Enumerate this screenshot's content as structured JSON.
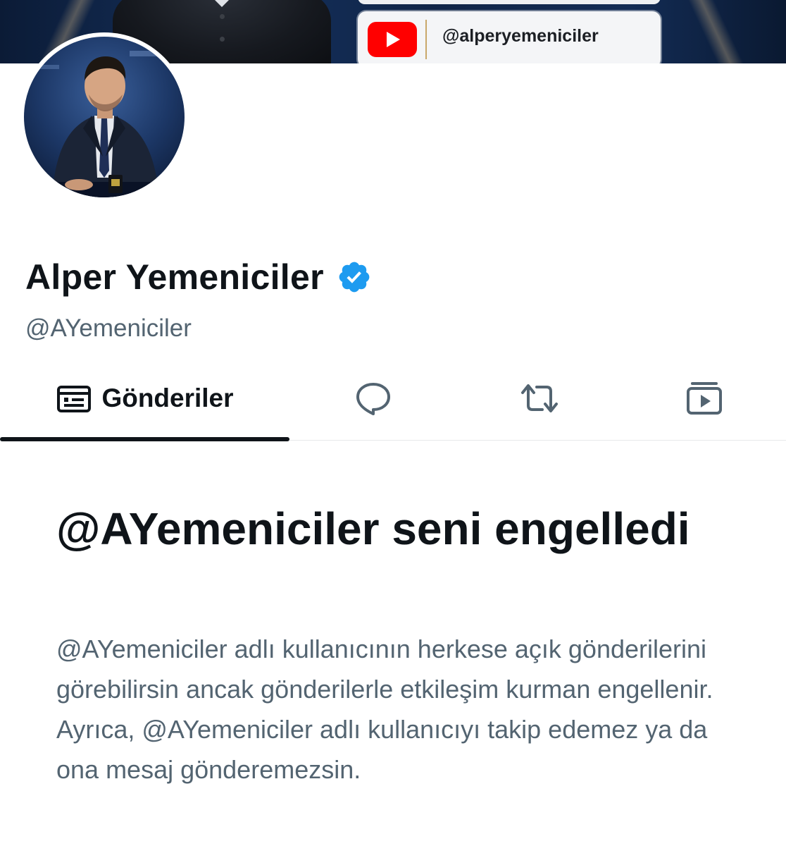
{
  "banner": {
    "youtube_handle": "@alperyemeniciler",
    "youtube_red": "#ff0000"
  },
  "profile": {
    "display_name": "Alper Yemeniciler",
    "handle": "@AYemeniciler",
    "verified": true,
    "verified_color": "#1d9bf0"
  },
  "tabs": [
    {
      "label": "Gönderiler",
      "icon": "posts-icon",
      "selected": true
    },
    {
      "label": "",
      "icon": "reply-icon",
      "selected": false
    },
    {
      "label": "",
      "icon": "repost-icon",
      "selected": false
    },
    {
      "label": "",
      "icon": "media-play-icon",
      "selected": false
    }
  ],
  "blocked": {
    "title": "@AYemeniciler seni engelledi",
    "body": "@AYemeniciler adlı kullanıcının herkese açık gönderilerini görebilirsin ancak gönderilerle etkileşim kurman engellenir. Ayrıca, @AYemeniciler adlı kullanıcıyı takip edemez ya da ona mesaj gönderemezsin."
  }
}
